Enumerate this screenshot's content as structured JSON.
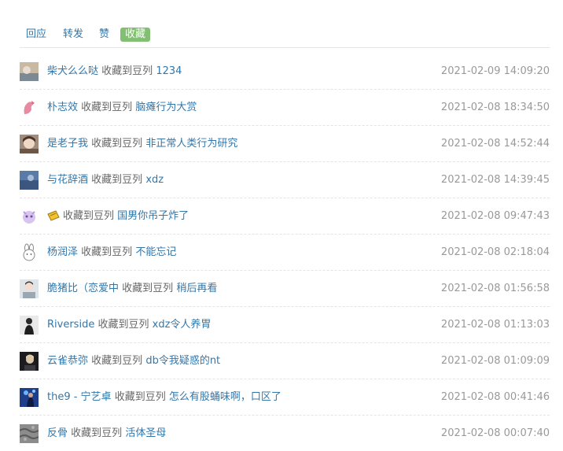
{
  "tabs": [
    {
      "label": "回应",
      "active": false
    },
    {
      "label": "转发",
      "active": false
    },
    {
      "label": "赞",
      "active": false
    },
    {
      "label": "收藏",
      "active": true
    }
  ],
  "action_text": "收藏到豆列",
  "items": [
    {
      "user": "柴犬么么哒",
      "doulist": "1234",
      "time": "2021-02-09 14:09:20"
    },
    {
      "user": "朴志效",
      "doulist": "脑瘫行为大赏",
      "time": "2021-02-08 18:34:50"
    },
    {
      "user": "是老子我",
      "doulist": "非正常人类行为研究",
      "time": "2021-02-08 14:52:44"
    },
    {
      "user": "与花辞酒",
      "doulist": "xdz",
      "time": "2021-02-08 14:39:45"
    },
    {
      "user": "",
      "user_icon": "yellow-ticket-emoji-icon",
      "doulist": "国男你吊子炸了",
      "time": "2021-02-08 09:47:43"
    },
    {
      "user": "杨润泽",
      "doulist": "不能忘记",
      "time": "2021-02-08 02:18:04"
    },
    {
      "user": "脆猪比（恋爱中",
      "doulist": "稍后再看",
      "time": "2021-02-08 01:56:58"
    },
    {
      "user": "Riverside",
      "doulist": "xdz令人养胃",
      "time": "2021-02-08 01:13:03"
    },
    {
      "user": "云雀恭弥",
      "doulist": "db令我疑惑的nt",
      "time": "2021-02-08 01:09:09"
    },
    {
      "user": "the9 - 宁艺卓",
      "doulist": "怎么有股蛹味啊，口区了",
      "time": "2021-02-08 00:41:46"
    },
    {
      "user": "反骨",
      "doulist": "活体圣母",
      "time": "2021-02-08 00:07:40"
    }
  ],
  "avatar_icons": [
    "avatar-photo-icon",
    "avatar-pink-creature-icon",
    "avatar-girl-portrait-icon",
    "avatar-blue-photo-icon",
    "avatar-purple-cartoon-icon",
    "avatar-rabbit-icon",
    "avatar-person-photo-icon",
    "avatar-dark-figure-icon",
    "avatar-night-photo-icon",
    "avatar-blue-stage-icon",
    "avatar-gray-texture-icon"
  ],
  "colors": {
    "link": "#3377aa",
    "muted": "#666666",
    "time": "#999999",
    "active_tab_bg": "#83bf73"
  }
}
